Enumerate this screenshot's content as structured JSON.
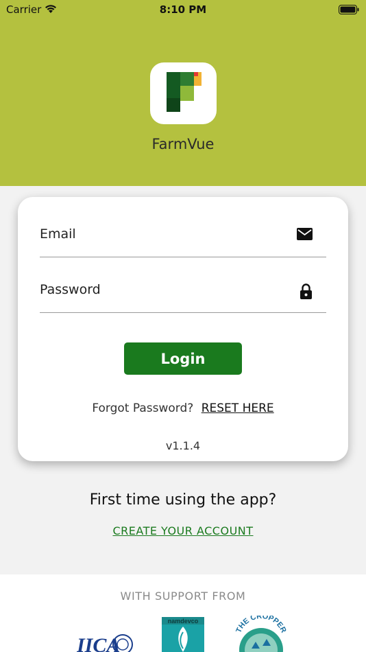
{
  "status_bar": {
    "carrier": "Carrier",
    "time": "8:10 PM"
  },
  "header": {
    "app_name": "FarmVue",
    "background_color": "#b4c13f"
  },
  "login_form": {
    "email_placeholder": "Email",
    "password_placeholder": "Password",
    "email_icon": "envelope-icon",
    "password_icon": "lock-icon",
    "login_button": "Login",
    "forgot_text": "Forgot Password?",
    "reset_link": "RESET HERE",
    "version": "v1.1.4"
  },
  "signup": {
    "question": "First time using the app?",
    "create_link": "CREATE YOUR ACCOUNT"
  },
  "support": {
    "title": "WITH SUPPORT FROM",
    "partners": {
      "iica": "IICA",
      "namdevco": "namdevco",
      "cropper": "THE CROPPER"
    }
  },
  "colors": {
    "accent_green": "#1a7a1e",
    "header_green": "#b4c13f"
  }
}
